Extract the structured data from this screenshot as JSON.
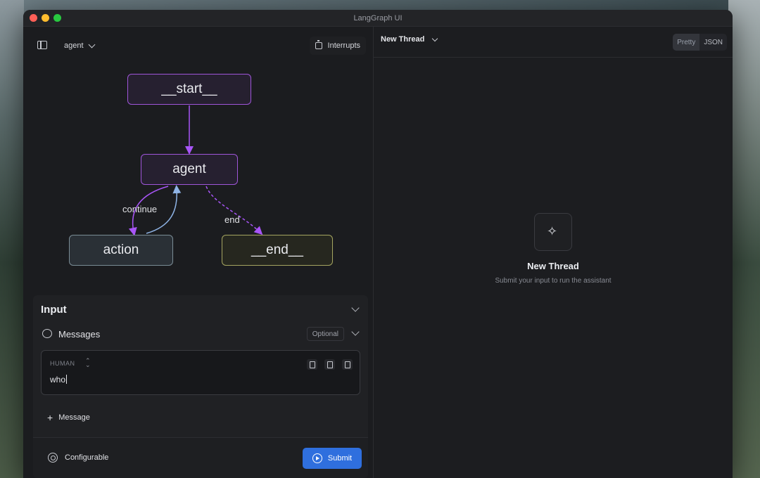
{
  "window": {
    "title": "LangGraph UI"
  },
  "left_toolbar": {
    "graph_name": "agent",
    "interrupts_label": "Interrupts"
  },
  "graph": {
    "nodes": {
      "start": "__start__",
      "agent": "agent",
      "action": "action",
      "end": "__end__"
    },
    "edges": {
      "continue": "continue",
      "end": "end"
    }
  },
  "input": {
    "title": "Input",
    "messages_label": "Messages",
    "optional_badge": "Optional",
    "message": {
      "role": "HUMAN",
      "text": "who"
    },
    "add_message_label": "Message",
    "configurable_label": "Configurable",
    "submit_label": "Submit"
  },
  "right": {
    "thread_name": "New Thread",
    "view_options": [
      "Pretty",
      "JSON"
    ],
    "selected_view": "Pretty",
    "empty_title": "New Thread",
    "empty_subtitle": "Submit your input to run the assistant"
  },
  "colors": {
    "accent": "#2f6fde",
    "node_purple": "#9f55d9",
    "edge_blue": "#7fa6d9",
    "end_yellow": "#a5a560"
  }
}
